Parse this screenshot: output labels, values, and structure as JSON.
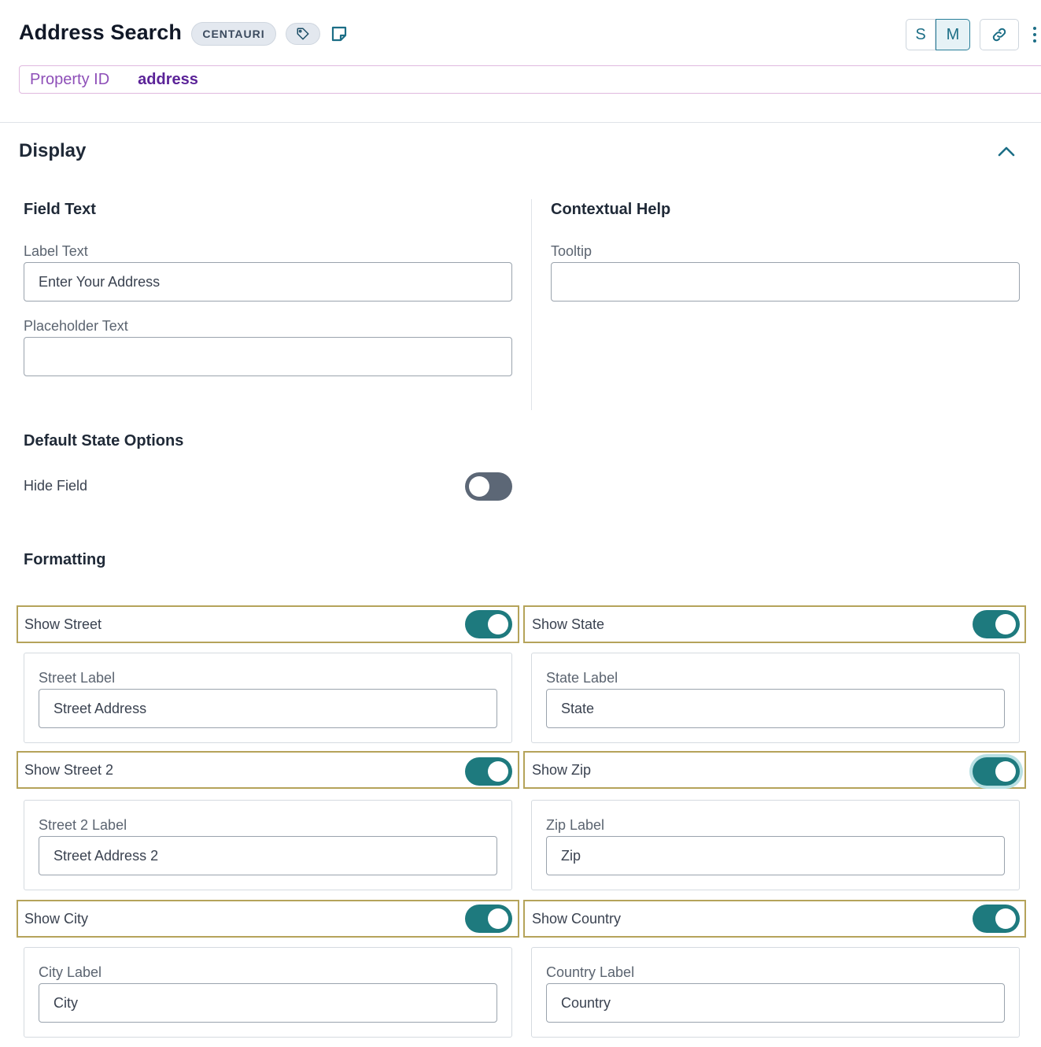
{
  "header": {
    "title": "Address Search",
    "badge": "CENTAURI",
    "size_options": [
      "S",
      "M"
    ],
    "selected_size": "M"
  },
  "property": {
    "label": "Property ID",
    "value": "address"
  },
  "display_section": {
    "title": "Display",
    "expanded": true
  },
  "field_text": {
    "heading": "Field Text",
    "label_text_label": "Label Text",
    "label_text_value": "Enter Your Address",
    "placeholder_label": "Placeholder Text",
    "placeholder_value": ""
  },
  "contextual_help": {
    "heading": "Contextual Help",
    "tooltip_label": "Tooltip",
    "tooltip_value": ""
  },
  "default_state": {
    "heading": "Default State Options",
    "hide_field_label": "Hide Field",
    "hide_field_on": false
  },
  "formatting": {
    "heading": "Formatting",
    "items": [
      {
        "toggle_label": "Show Street",
        "on": true,
        "field_label": "Street Label",
        "field_value": "Street Address"
      },
      {
        "toggle_label": "Show State",
        "on": true,
        "field_label": "State Label",
        "field_value": "State"
      },
      {
        "toggle_label": "Show Street 2",
        "on": true,
        "field_label": "Street 2 Label",
        "field_value": "Street Address 2"
      },
      {
        "toggle_label": "Show Zip",
        "on": true,
        "field_label": "Zip Label",
        "field_value": "Zip"
      },
      {
        "toggle_label": "Show City",
        "on": true,
        "field_label": "City Label",
        "field_value": "City"
      },
      {
        "toggle_label": "Show Country",
        "on": true,
        "field_label": "Country Label",
        "field_value": "Country"
      }
    ]
  },
  "colors": {
    "accent": "#1e7a7e",
    "toggle_off": "#5c6776",
    "row_border": "#b5a35a",
    "property_value": "#5b2398"
  }
}
